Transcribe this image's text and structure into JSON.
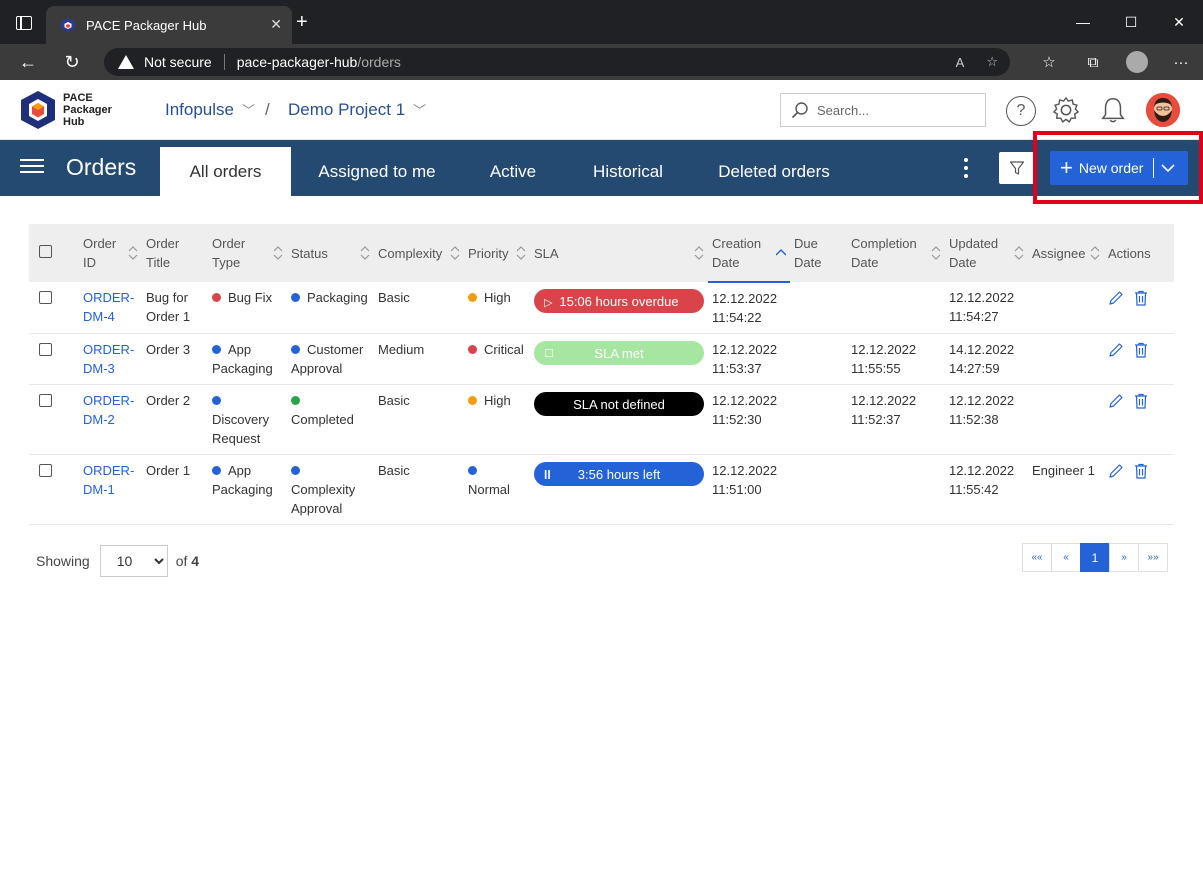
{
  "browser": {
    "tab_title": "PACE Packager Hub",
    "not_secure": "Not secure",
    "url_host": "pace-packager-hub",
    "url_path": "/orders"
  },
  "header": {
    "logo_line1": "PACE",
    "logo_line2": "Packager",
    "logo_line3": "Hub",
    "breadcrumb_org": "Infopulse",
    "breadcrumb_project": "Demo Project 1",
    "search_placeholder": "Search..."
  },
  "nav": {
    "title": "Orders",
    "tabs": [
      "All orders",
      "Assigned to me",
      "Active",
      "Historical",
      "Deleted orders"
    ],
    "new_order": "New order"
  },
  "table": {
    "headers": {
      "order_id": [
        "Order",
        "ID"
      ],
      "order_title": [
        "Order",
        "Title"
      ],
      "order_type": [
        "Order",
        "Type"
      ],
      "status": "Status",
      "complexity": "Complexity",
      "priority": "Priority",
      "sla": "SLA",
      "creation_date": [
        "Creation",
        "Date"
      ],
      "due_date": [
        "Due",
        "Date"
      ],
      "completion_date": [
        "Completion",
        "Date"
      ],
      "updated_date": [
        "Updated",
        "Date"
      ],
      "assignee": "Assignee",
      "actions": "Actions"
    },
    "rows": [
      {
        "id": [
          "ORDER-",
          "DM-4"
        ],
        "title": [
          "Bug for",
          "Order 1"
        ],
        "type": "Bug Fix",
        "status": "Packaging",
        "complexity": "Basic",
        "priority": "High",
        "sla": "15:06 hours overdue",
        "created": [
          "12.12.2022",
          "11:54:22"
        ],
        "due": [
          "",
          ""
        ],
        "completed": [
          "",
          ""
        ],
        "updated": [
          "12.12.2022",
          "11:54:27"
        ],
        "assignee": ""
      },
      {
        "id": [
          "ORDER-",
          "DM-3"
        ],
        "title": [
          "Order 3",
          ""
        ],
        "type": "App Packaging",
        "status": "Customer Approval",
        "complexity": "Medium",
        "priority": "Critical",
        "sla": "SLA met",
        "created": [
          "12.12.2022",
          "11:53:37"
        ],
        "due": [
          "",
          ""
        ],
        "completed": [
          "12.12.2022",
          "11:55:55"
        ],
        "updated": [
          "14.12.2022",
          "14:27:59"
        ],
        "assignee": ""
      },
      {
        "id": [
          "ORDER-",
          "DM-2"
        ],
        "title": [
          "Order 2",
          ""
        ],
        "type": "Discovery Request",
        "status": "Completed",
        "complexity": "Basic",
        "priority": "High",
        "sla": "SLA not defined",
        "created": [
          "12.12.2022",
          "11:52:30"
        ],
        "due": [
          "",
          ""
        ],
        "completed": [
          "12.12.2022",
          "11:52:37"
        ],
        "updated": [
          "12.12.2022",
          "11:52:38"
        ],
        "assignee": ""
      },
      {
        "id": [
          "ORDER-",
          "DM-1"
        ],
        "title": [
          "Order 1",
          ""
        ],
        "type": "App Packaging",
        "status": "Complexity Approval",
        "complexity": "Basic",
        "priority": "Normal",
        "sla": "3:56 hours left",
        "created": [
          "12.12.2022",
          "11:51:00"
        ],
        "due": [
          "",
          ""
        ],
        "completed": [
          "",
          ""
        ],
        "updated": [
          "12.12.2022",
          "11:55:42"
        ],
        "assignee": "Engineer 1"
      }
    ]
  },
  "footer": {
    "showing_label": "Showing",
    "page_size": "10",
    "of_label": "of",
    "total": "4",
    "pager": [
      "««",
      "«",
      "1",
      "»",
      "»»"
    ]
  },
  "colors": {
    "nav_bg": "#244a72",
    "accent": "#2462d8",
    "overdue": "#d9444a",
    "met": "#a6e6a0",
    "undefined": "#000000",
    "left": "#2462d8",
    "dot_red": "#d9444a",
    "dot_blue": "#2462d8",
    "dot_green": "#27a54a",
    "dot_orange": "#f39c12",
    "highlight": "#e0001b"
  }
}
